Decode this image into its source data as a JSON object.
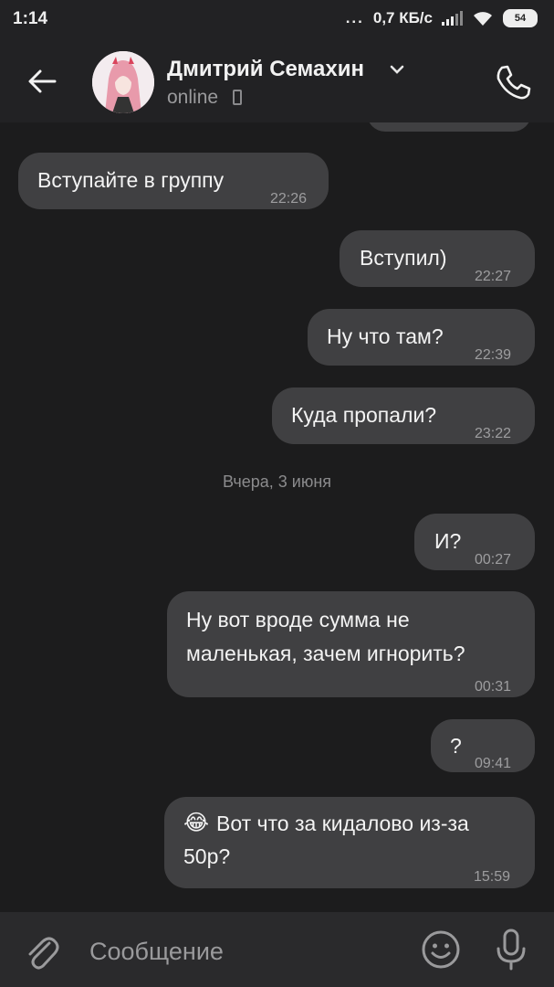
{
  "status_bar": {
    "time": "1:14",
    "dots": "...",
    "net_speed": "0,7 КБ/с",
    "battery": "54"
  },
  "header": {
    "contact_name": "Дмитрий Семахин",
    "status": "online"
  },
  "chat": {
    "messages": [
      {
        "direction": "out",
        "text": "",
        "time": ""
      },
      {
        "direction": "in",
        "text": "Вступайте в группу",
        "time": "22:26"
      },
      {
        "direction": "out",
        "text": "Вступил)",
        "time": "22:27"
      },
      {
        "direction": "out",
        "text": "Ну что там?",
        "time": "22:39"
      },
      {
        "direction": "out",
        "text": "Куда пропали?",
        "time": "23:22"
      },
      {
        "direction": "out",
        "text": "И?",
        "time": "00:27"
      },
      {
        "direction": "out",
        "text_line1": "Ну вот вроде сумма не",
        "text_line2": "маленькая, зачем игнорить?",
        "time": "00:31"
      },
      {
        "direction": "out",
        "text": "?",
        "time": "09:41"
      },
      {
        "direction": "out",
        "emoji": "😂",
        "text_line1": "Вот что за кидалово из-за",
        "text_line2": "50р?",
        "time": "15:59"
      }
    ],
    "date_separator": "Вчера, 3 июня"
  },
  "composer": {
    "placeholder": "Сообщение"
  },
  "colors": {
    "background": "#1c1c1d",
    "header": "#222224",
    "bubble": "#404042",
    "composer": "#2a2a2c"
  },
  "icons": [
    "back-arrow-icon",
    "chevron-down-icon",
    "mobile-phone-icon",
    "phone-icon",
    "paperclip-icon",
    "smiley-icon",
    "microphone-icon",
    "wifi-icon",
    "signal-icon",
    "battery-icon"
  ]
}
